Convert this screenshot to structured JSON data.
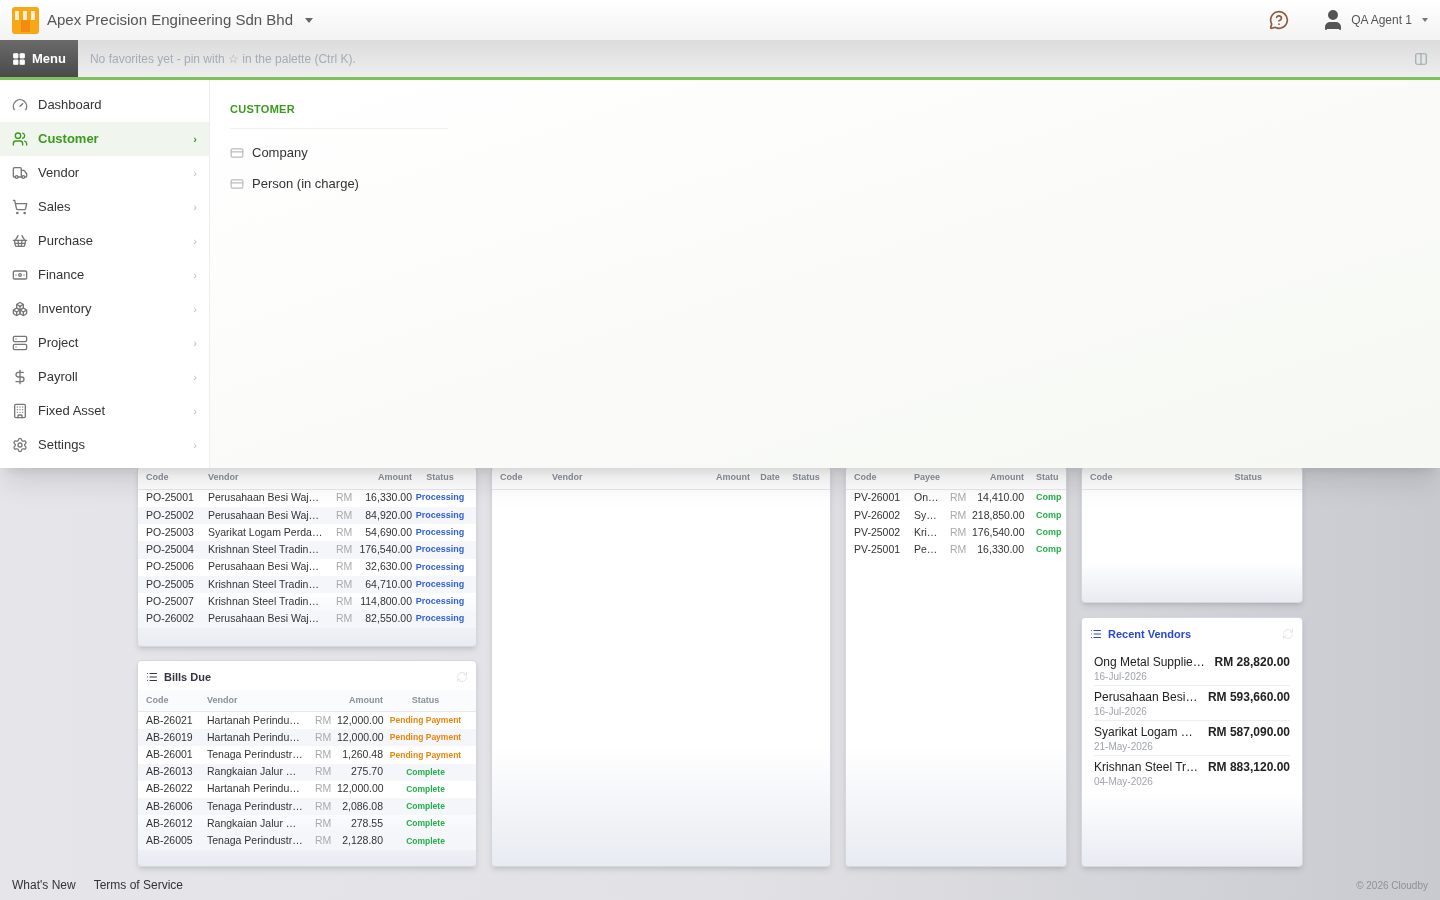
{
  "company": "Apex Precision Engineering Sdn Bhd",
  "user": "QA Agent 1",
  "menu_button": "Menu",
  "favorites_hint": "No favorites yet - pin with ☆ in the palette (Ctrl K).",
  "menu": {
    "items": [
      {
        "label": "Dashboard",
        "selected": false,
        "has_submenu": false
      },
      {
        "label": "Customer",
        "selected": true,
        "has_submenu": true
      },
      {
        "label": "Vendor",
        "selected": false,
        "has_submenu": true
      },
      {
        "label": "Sales",
        "selected": false,
        "has_submenu": true
      },
      {
        "label": "Purchase",
        "selected": false,
        "has_submenu": true
      },
      {
        "label": "Finance",
        "selected": false,
        "has_submenu": true
      },
      {
        "label": "Inventory",
        "selected": false,
        "has_submenu": true
      },
      {
        "label": "Project",
        "selected": false,
        "has_submenu": true
      },
      {
        "label": "Payroll",
        "selected": false,
        "has_submenu": true
      },
      {
        "label": "Fixed Asset",
        "selected": false,
        "has_submenu": true
      },
      {
        "label": "Settings",
        "selected": false,
        "has_submenu": true
      }
    ],
    "submenu_arrow": "›"
  },
  "submenu": {
    "title": "CUSTOMER",
    "items": [
      "Company",
      "Person (in charge)"
    ]
  },
  "purchase_orders": {
    "columns": [
      "Code",
      "Vendor",
      "Amount",
      "Status"
    ],
    "rows": [
      {
        "code": "PO-25001",
        "vendor": "Perusahaan Besi Waj…",
        "currency": "RM",
        "amount": "16,330.00",
        "status": "Processing",
        "kind": "processing"
      },
      {
        "code": "PO-25002",
        "vendor": "Perusahaan Besi Waj…",
        "currency": "RM",
        "amount": "84,920.00",
        "status": "Processing",
        "kind": "processing"
      },
      {
        "code": "PO-25003",
        "vendor": "Syarikat Logam Perda…",
        "currency": "RM",
        "amount": "54,690.00",
        "status": "Processing",
        "kind": "processing"
      },
      {
        "code": "PO-25004",
        "vendor": "Krishnan Steel Tradin…",
        "currency": "RM",
        "amount": "176,540.00",
        "status": "Processing",
        "kind": "processing"
      },
      {
        "code": "PO-25006",
        "vendor": "Perusahaan Besi Waj…",
        "currency": "RM",
        "amount": "32,630.00",
        "status": "Processing",
        "kind": "processing"
      },
      {
        "code": "PO-25005",
        "vendor": "Krishnan Steel Tradin…",
        "currency": "RM",
        "amount": "64,710.00",
        "status": "Processing",
        "kind": "processing"
      },
      {
        "code": "PO-25007",
        "vendor": "Krishnan Steel Tradin…",
        "currency": "RM",
        "amount": "114,800.00",
        "status": "Processing",
        "kind": "processing"
      },
      {
        "code": "PO-26002",
        "vendor": "Perusahaan Besi Waj…",
        "currency": "RM",
        "amount": "82,550.00",
        "status": "Processing",
        "kind": "processing"
      }
    ]
  },
  "bills_due": {
    "title": "Bills Due",
    "columns": [
      "Code",
      "Vendor",
      "Amount",
      "Status"
    ],
    "rows": [
      {
        "code": "AB-26021",
        "vendor": "Hartanah Perindu…",
        "currency": "RM",
        "amount": "12,000.00",
        "status": "Pending Payment",
        "kind": "pending"
      },
      {
        "code": "AB-26019",
        "vendor": "Hartanah Perindu…",
        "currency": "RM",
        "amount": "12,000.00",
        "status": "Pending Payment",
        "kind": "pending"
      },
      {
        "code": "AB-26001",
        "vendor": "Tenaga Perindustr…",
        "currency": "RM",
        "amount": "1,260.48",
        "status": "Pending Payment",
        "kind": "pending"
      },
      {
        "code": "AB-26013",
        "vendor": "Rangkaian Jalur …",
        "currency": "RM",
        "amount": "275.70",
        "status": "Complete",
        "kind": "complete"
      },
      {
        "code": "AB-26022",
        "vendor": "Hartanah Perindu…",
        "currency": "RM",
        "amount": "12,000.00",
        "status": "Complete",
        "kind": "complete"
      },
      {
        "code": "AB-26006",
        "vendor": "Tenaga Perindustr…",
        "currency": "RM",
        "amount": "2,086.08",
        "status": "Complete",
        "kind": "complete"
      },
      {
        "code": "AB-26012",
        "vendor": "Rangkaian Jalur …",
        "currency": "RM",
        "amount": "278.55",
        "status": "Complete",
        "kind": "complete"
      },
      {
        "code": "AB-26005",
        "vendor": "Tenaga Perindustr…",
        "currency": "RM",
        "amount": "2,128.80",
        "status": "Complete",
        "kind": "complete"
      }
    ]
  },
  "vendor_bills": {
    "columns": [
      "Code",
      "Vendor",
      "Amount",
      "Date",
      "Status"
    ]
  },
  "payments": {
    "columns": [
      "Code",
      "Payee",
      "Amount",
      "Statu"
    ],
    "rows": [
      {
        "code": "PV-26001",
        "payee": "On…",
        "currency": "RM",
        "amount": "14,410.00",
        "status": "Comp",
        "kind": "complete"
      },
      {
        "code": "PV-26002",
        "payee": "Sy…",
        "currency": "RM",
        "amount": "218,850.00",
        "status": "Comp",
        "kind": "complete"
      },
      {
        "code": "PV-25002",
        "payee": "Kri…",
        "currency": "RM",
        "amount": "176,540.00",
        "status": "Comp",
        "kind": "complete"
      },
      {
        "code": "PV-25001",
        "payee": "Pe…",
        "currency": "RM",
        "amount": "16,330.00",
        "status": "Comp",
        "kind": "complete"
      }
    ]
  },
  "small_table": {
    "columns": [
      "Code",
      "Status"
    ]
  },
  "recent_vendors": {
    "title": "Recent Vendors",
    "items": [
      {
        "name": "Ong Metal Supplie…",
        "amount": "RM 28,820.00",
        "date": "16-Jul-2026"
      },
      {
        "name": "Perusahaan Besi…",
        "amount": "RM 593,660.00",
        "date": "16-Jul-2026"
      },
      {
        "name": "Syarikat Logam …",
        "amount": "RM 587,090.00",
        "date": "21-May-2026"
      },
      {
        "name": "Krishnan Steel Tr…",
        "amount": "RM 883,120.00",
        "date": "04-May-2026"
      }
    ]
  },
  "footer": {
    "links": [
      "What's New",
      "Terms of Service"
    ],
    "copyright": "© 2026 Cloudby"
  }
}
